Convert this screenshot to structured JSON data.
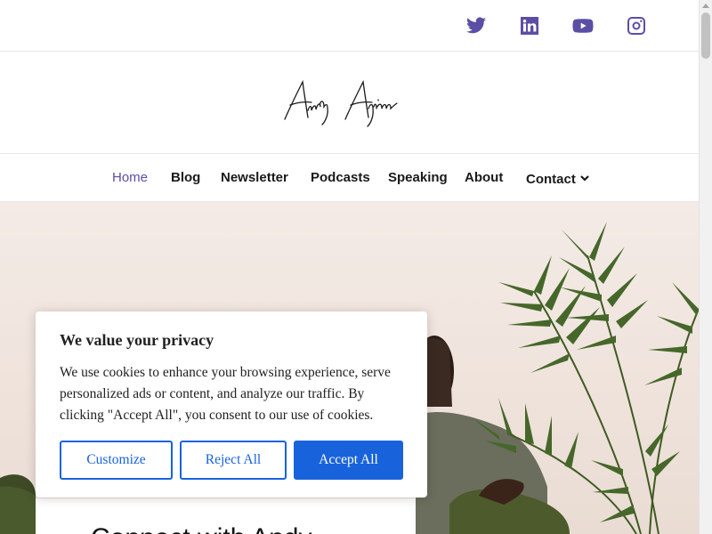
{
  "social": [
    {
      "name": "twitter-icon"
    },
    {
      "name": "linkedin-icon"
    },
    {
      "name": "youtube-icon"
    },
    {
      "name": "instagram-icon"
    }
  ],
  "brand": {
    "logo_text": "Andy Ayim"
  },
  "nav": {
    "items": [
      {
        "label": "Home",
        "active": true
      },
      {
        "label": "Blog"
      },
      {
        "label": "Newsletter"
      },
      {
        "label": "Podcasts"
      },
      {
        "label": "Speaking"
      },
      {
        "label": "About"
      },
      {
        "label": "Contact",
        "has_dropdown": true
      }
    ]
  },
  "cookie": {
    "title": "We value your privacy",
    "body": "We use cookies to enhance your browsing experience, serve personalized ads or content, and analyze our traffic. By clicking \"Accept All\", you consent to our use of cookies.",
    "customize_label": "Customize",
    "reject_label": "Reject All",
    "accept_label": "Accept All"
  },
  "hero": {
    "heading_partial": "Connect with Andy"
  },
  "colors": {
    "accent": "#5b4ea6",
    "button_blue": "#1863dc",
    "text": "#1a1a1a"
  }
}
